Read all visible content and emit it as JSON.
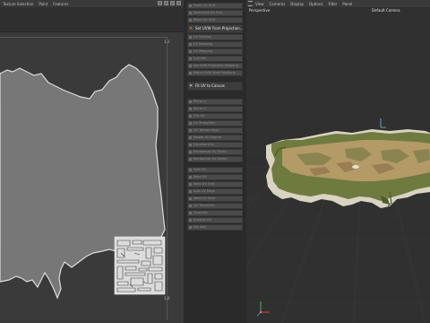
{
  "uv_editor": {
    "menu": [
      "Texture Selection",
      "Paint",
      "Features"
    ],
    "corner_top": "1,1",
    "corner_bottom": "1,0"
  },
  "command_palette": {
    "group1": [
      "Scale UV Grid",
      "Normalize UV Grid",
      "Relax UV Grid"
    ],
    "uv_projection_label": "Set UVW From Projection...",
    "group2": [
      "UV Packing",
      "UV Relaxing",
      "UV Mapping",
      "Cylinder",
      "Set UVW Projection Mapping",
      "Match UVW Shell Positions"
    ],
    "fit_uv_label": "Fit UV to Canvas",
    "group3": [
      "Mirror U",
      "Mirror V",
      "Flip UV",
      "UV Straighten",
      "UV Terrace Align",
      "Rotate 90 Degree",
      "Equalize UVs",
      "Randomize UV Shells",
      "Randomize UV Shells"
    ],
    "group4": [
      "Split UV",
      "Weld UV",
      "Weld UV Grid",
      "Split UV Edge",
      "Weld UV Point",
      "UV Transform",
      "Quantize",
      "Analyze UV",
      "Set Add"
    ]
  },
  "viewport": {
    "menu": [
      "View",
      "Cameras",
      "Display",
      "Options",
      "Filter",
      "Panel"
    ],
    "view_mode": "Perspective",
    "camera": "Default Camera"
  },
  "colors": {
    "uv_shape_fill": "#777777",
    "uv_shape_stroke": "#dcdcdc",
    "terrain_green": "#6f7a3f",
    "terrain_tan": "#b39a66",
    "terrain_edge": "#d9d3c2",
    "accent_orange": "#e8a13b"
  }
}
